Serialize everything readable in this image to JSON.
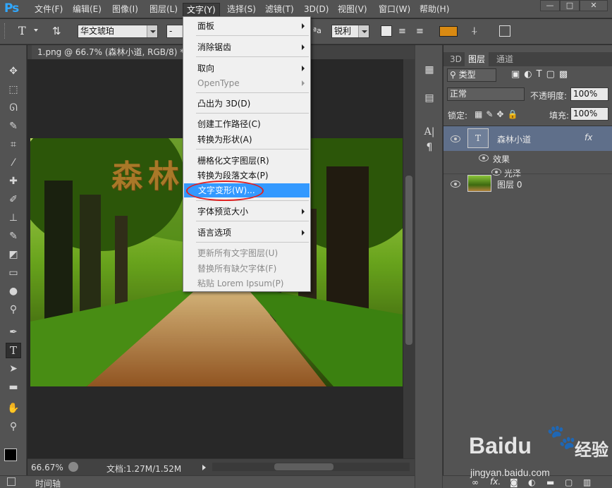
{
  "app": {
    "logo": "Ps"
  },
  "menubar": {
    "items": [
      "文件(F)",
      "编辑(E)",
      "图像(I)",
      "图层(L)",
      "文字(Y)",
      "选择(S)",
      "滤镜(T)",
      "3D(D)",
      "视图(V)",
      "窗口(W)",
      "帮助(H)"
    ],
    "active": "文字(Y)"
  },
  "window_controls": {
    "minimize": "—",
    "restore": "□",
    "close": "✕"
  },
  "options": {
    "tool_glyph": "T",
    "font_family": "华文琥珀",
    "font_style": "-",
    "aa_label": "ªa",
    "antialias": "锐利",
    "color_swatch": "#d98a12"
  },
  "document": {
    "tab_title": "1.png @ 66.7% (森林小道, RGB/8) *",
    "tab_close": "×",
    "canvas_text": "森林小道",
    "text_color": "#b07a2a"
  },
  "status": {
    "zoom": "66.67%",
    "doc_info": "文档:1.27M/1.52M"
  },
  "timeline_label": "时间轴",
  "text_menu": {
    "items": [
      {
        "label": "面板",
        "submenu": true,
        "disabled": false
      },
      {
        "label": "消除锯齿",
        "submenu": true,
        "disabled": false
      },
      {
        "label": "取向",
        "submenu": true,
        "disabled": false
      },
      {
        "label": "OpenType",
        "submenu": true,
        "disabled": true
      },
      {
        "label": "凸出为 3D(D)",
        "submenu": false,
        "disabled": false
      },
      {
        "label": "创建工作路径(C)",
        "submenu": false,
        "disabled": false
      },
      {
        "label": "转换为形状(A)",
        "submenu": false,
        "disabled": false
      },
      {
        "label": "栅格化文字图层(R)",
        "submenu": false,
        "disabled": false
      },
      {
        "label": "转换为段落文本(P)",
        "submenu": false,
        "disabled": false
      },
      {
        "label": "文字变形(W)...",
        "submenu": false,
        "disabled": false,
        "highlighted": true
      },
      {
        "label": "字体预览大小",
        "submenu": true,
        "disabled": false
      },
      {
        "label": "语言选项",
        "submenu": true,
        "disabled": false
      },
      {
        "label": "更新所有文字图层(U)",
        "submenu": false,
        "disabled": true
      },
      {
        "label": "替换所有缺欠字体(F)",
        "submenu": false,
        "disabled": true
      },
      {
        "label": "粘贴 Lorem Ipsum(P)",
        "submenu": false,
        "disabled": true
      }
    ],
    "highlight_color": "#3399ff"
  },
  "layers_panel": {
    "tabs": [
      "3D",
      "图层",
      "通道"
    ],
    "active_tab": "图层",
    "filter_kind": "类型",
    "blend_mode": "正常",
    "opacity_label": "不透明度:",
    "opacity_value": "100%",
    "lock_label": "锁定:",
    "fill_label": "填充:",
    "fill_value": "100%",
    "layers": [
      {
        "name": "森林小道",
        "kind": "text",
        "fx": "fx",
        "selected": true
      },
      {
        "name": "效果",
        "kind": "effects-header"
      },
      {
        "name": "光泽",
        "kind": "effect"
      },
      {
        "name": "图层 0",
        "kind": "image"
      }
    ],
    "footer_icons": [
      "link-icon",
      "fx-icon",
      "mask-icon",
      "adjustment-icon",
      "group-icon",
      "new-layer-icon",
      "trash-icon"
    ]
  },
  "watermark": {
    "brand": "Baidu",
    "brand_cn": "经验",
    "url": "jingyan.baidu.com"
  }
}
